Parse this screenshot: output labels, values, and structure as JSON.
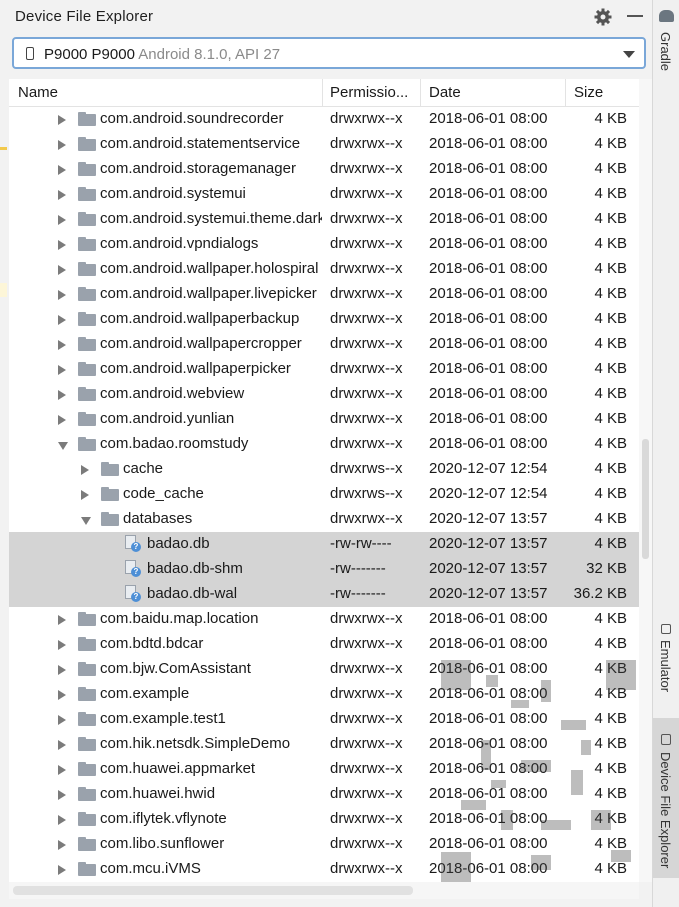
{
  "panel": {
    "title": "Device File Explorer",
    "device": {
      "name": "P9000 P9000",
      "meta": "Android 8.1.0, API 27"
    }
  },
  "columns": {
    "name": "Name",
    "permissions": "Permissio...",
    "date": "Date",
    "size": "Size"
  },
  "rows": [
    {
      "level": 1,
      "kind": "folder",
      "expanded": false,
      "name": "com.android.soundrecorder",
      "permissions": "drwxrwx--x",
      "date": "2018-06-01 08:00",
      "size": "4 KB"
    },
    {
      "level": 1,
      "kind": "folder",
      "expanded": false,
      "name": "com.android.statementservice",
      "permissions": "drwxrwx--x",
      "date": "2018-06-01 08:00",
      "size": "4 KB"
    },
    {
      "level": 1,
      "kind": "folder",
      "expanded": false,
      "name": "com.android.storagemanager",
      "permissions": "drwxrwx--x",
      "date": "2018-06-01 08:00",
      "size": "4 KB"
    },
    {
      "level": 1,
      "kind": "folder",
      "expanded": false,
      "name": "com.android.systemui",
      "permissions": "drwxrwx--x",
      "date": "2018-06-01 08:00",
      "size": "4 KB"
    },
    {
      "level": 1,
      "kind": "folder",
      "expanded": false,
      "name": "com.android.systemui.theme.dark",
      "permissions": "drwxrwx--x",
      "date": "2018-06-01 08:00",
      "size": "4 KB"
    },
    {
      "level": 1,
      "kind": "folder",
      "expanded": false,
      "name": "com.android.vpndialogs",
      "permissions": "drwxrwx--x",
      "date": "2018-06-01 08:00",
      "size": "4 KB"
    },
    {
      "level": 1,
      "kind": "folder",
      "expanded": false,
      "name": "com.android.wallpaper.holospiral",
      "permissions": "drwxrwx--x",
      "date": "2018-06-01 08:00",
      "size": "4 KB"
    },
    {
      "level": 1,
      "kind": "folder",
      "expanded": false,
      "name": "com.android.wallpaper.livepicker",
      "permissions": "drwxrwx--x",
      "date": "2018-06-01 08:00",
      "size": "4 KB"
    },
    {
      "level": 1,
      "kind": "folder",
      "expanded": false,
      "name": "com.android.wallpaperbackup",
      "permissions": "drwxrwx--x",
      "date": "2018-06-01 08:00",
      "size": "4 KB"
    },
    {
      "level": 1,
      "kind": "folder",
      "expanded": false,
      "name": "com.android.wallpapercropper",
      "permissions": "drwxrwx--x",
      "date": "2018-06-01 08:00",
      "size": "4 KB"
    },
    {
      "level": 1,
      "kind": "folder",
      "expanded": false,
      "name": "com.android.wallpaperpicker",
      "permissions": "drwxrwx--x",
      "date": "2018-06-01 08:00",
      "size": "4 KB"
    },
    {
      "level": 1,
      "kind": "folder",
      "expanded": false,
      "name": "com.android.webview",
      "permissions": "drwxrwx--x",
      "date": "2018-06-01 08:00",
      "size": "4 KB"
    },
    {
      "level": 1,
      "kind": "folder",
      "expanded": false,
      "name": "com.android.yunlian",
      "permissions": "drwxrwx--x",
      "date": "2018-06-01 08:00",
      "size": "4 KB"
    },
    {
      "level": 1,
      "kind": "folder",
      "expanded": true,
      "name": "com.badao.roomstudy",
      "permissions": "drwxrwx--x",
      "date": "2018-06-01 08:00",
      "size": "4 KB"
    },
    {
      "level": 2,
      "kind": "folder",
      "expanded": false,
      "name": "cache",
      "permissions": "drwxrws--x",
      "date": "2020-12-07 12:54",
      "size": "4 KB"
    },
    {
      "level": 2,
      "kind": "folder",
      "expanded": false,
      "name": "code_cache",
      "permissions": "drwxrws--x",
      "date": "2020-12-07 12:54",
      "size": "4 KB"
    },
    {
      "level": 2,
      "kind": "folder",
      "expanded": true,
      "name": "databases",
      "permissions": "drwxrwx--x",
      "date": "2020-12-07 13:57",
      "size": "4 KB"
    },
    {
      "level": 3,
      "kind": "file",
      "selected": true,
      "name": "badao.db",
      "permissions": "-rw-rw----",
      "date": "2020-12-07 13:57",
      "size": "4 KB"
    },
    {
      "level": 3,
      "kind": "file",
      "selected": true,
      "name": "badao.db-shm",
      "permissions": "-rw-------",
      "date": "2020-12-07 13:57",
      "size": "32 KB"
    },
    {
      "level": 3,
      "kind": "file",
      "selected": true,
      "name": "badao.db-wal",
      "permissions": "-rw-------",
      "date": "2020-12-07 13:57",
      "size": "36.2 KB"
    },
    {
      "level": 1,
      "kind": "folder",
      "expanded": false,
      "name": "com.baidu.map.location",
      "permissions": "drwxrwx--x",
      "date": "2018-06-01 08:00",
      "size": "4 KB"
    },
    {
      "level": 1,
      "kind": "folder",
      "expanded": false,
      "name": "com.bdtd.bdcar",
      "permissions": "drwxrwx--x",
      "date": "2018-06-01 08:00",
      "size": "4 KB"
    },
    {
      "level": 1,
      "kind": "folder",
      "expanded": false,
      "name": "com.bjw.ComAssistant",
      "permissions": "drwxrwx--x",
      "date": "2018-06-01 08:00",
      "size": "4 KB"
    },
    {
      "level": 1,
      "kind": "folder",
      "expanded": false,
      "name": "com.example",
      "permissions": "drwxrwx--x",
      "date": "2018-06-01 08:00",
      "size": "4 KB"
    },
    {
      "level": 1,
      "kind": "folder",
      "expanded": false,
      "name": "com.example.test1",
      "permissions": "drwxrwx--x",
      "date": "2018-06-01 08:00",
      "size": "4 KB"
    },
    {
      "level": 1,
      "kind": "folder",
      "expanded": false,
      "name": "com.hik.netsdk.SimpleDemo",
      "permissions": "drwxrwx--x",
      "date": "2018-06-01 08:00",
      "size": "4 KB"
    },
    {
      "level": 1,
      "kind": "folder",
      "expanded": false,
      "name": "com.huawei.appmarket",
      "permissions": "drwxrwx--x",
      "date": "2018-06-01 08:00",
      "size": "4 KB"
    },
    {
      "level": 1,
      "kind": "folder",
      "expanded": false,
      "name": "com.huawei.hwid",
      "permissions": "drwxrwx--x",
      "date": "2018-06-01 08:00",
      "size": "4 KB"
    },
    {
      "level": 1,
      "kind": "folder",
      "expanded": false,
      "name": "com.iflytek.vflynote",
      "permissions": "drwxrwx--x",
      "date": "2018-06-01 08:00",
      "size": "4 KB"
    },
    {
      "level": 1,
      "kind": "folder",
      "expanded": false,
      "name": "com.libo.sunflower",
      "permissions": "drwxrwx--x",
      "date": "2018-06-01 08:00",
      "size": "4 KB"
    },
    {
      "level": 1,
      "kind": "folder",
      "expanded": false,
      "name": "com.mcu.iVMS",
      "permissions": "drwxrwx--x",
      "date": "2018-06-01 08:00",
      "size": "4 KB"
    }
  ],
  "rail": {
    "gradle": "Gradle",
    "emulator": "Emulator",
    "device_file_explorer": "Device File Explorer"
  },
  "icons": {
    "settings": "gear-icon",
    "minimize": "minimize-icon",
    "device": "phone-icon",
    "folder": "folder-icon",
    "file": "unknown-file-icon"
  },
  "colors": {
    "selection": "#d4d4d4",
    "focus_border": "#7aa7d8",
    "file_badge": "#4d8fd6"
  }
}
